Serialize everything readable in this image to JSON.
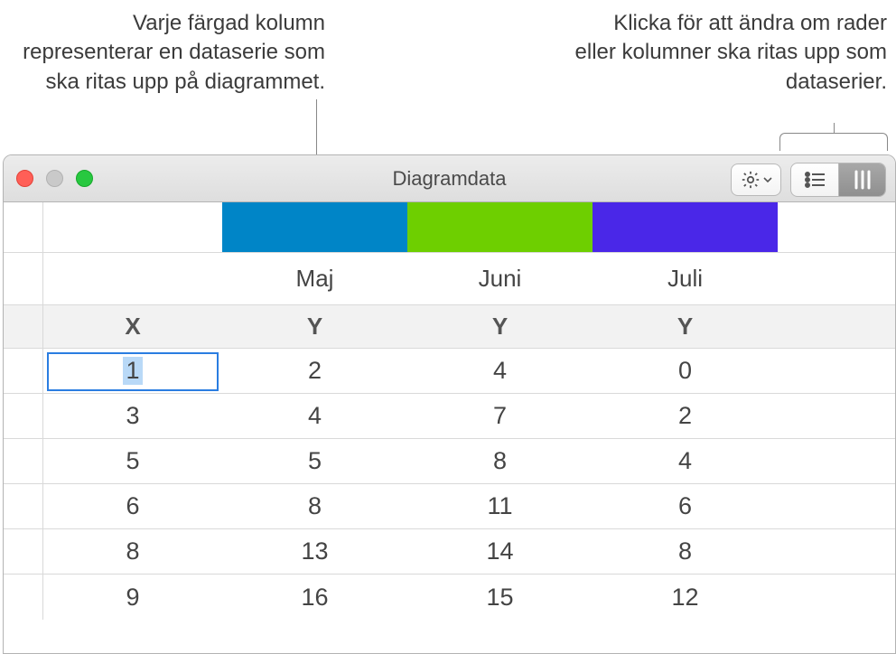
{
  "callouts": {
    "left": "Varje färgad kolumn representerar en dataserie som ska ritas upp på diagrammet.",
    "right": "Klicka för att ändra om rader eller kolumner ska ritas upp som dataserier."
  },
  "window": {
    "title": "Diagramdata"
  },
  "toolbar": {
    "gear_icon": "gear",
    "row_series_icon": "rows",
    "col_series_icon": "columns"
  },
  "series_colors": [
    "#0085c7",
    "#6ecf00",
    "#4a27e8"
  ],
  "column_headers": [
    "Maj",
    "Juni",
    "Juli"
  ],
  "axis_labels": {
    "x": "X",
    "y": "Y"
  },
  "data_rows": [
    {
      "x": "1",
      "y": [
        "2",
        "4",
        "0"
      ]
    },
    {
      "x": "3",
      "y": [
        "4",
        "7",
        "2"
      ]
    },
    {
      "x": "5",
      "y": [
        "5",
        "8",
        "4"
      ]
    },
    {
      "x": "6",
      "y": [
        "8",
        "11",
        "6"
      ]
    },
    {
      "x": "8",
      "y": [
        "13",
        "14",
        "8"
      ]
    },
    {
      "x": "9",
      "y": [
        "16",
        "15",
        "12"
      ]
    }
  ],
  "selected_cell": {
    "row": 0,
    "col": "x"
  }
}
